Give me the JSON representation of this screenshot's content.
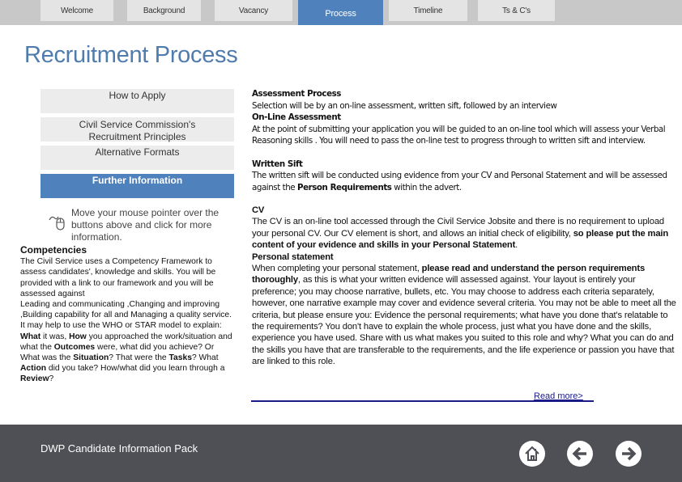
{
  "tabs": [
    {
      "label": "Welcome",
      "active": false
    },
    {
      "label": "Background",
      "active": false
    },
    {
      "label": "Vacancy",
      "active": false
    },
    {
      "label": "Process",
      "active": true
    },
    {
      "label": "Timeline",
      "active": false
    },
    {
      "label": "Ts & C's",
      "active": false
    }
  ],
  "page_title": "Recruitment Process",
  "side_buttons": [
    {
      "label": "How to Apply"
    },
    {
      "label": "Civil Service Commission's Recruitment Principles"
    },
    {
      "label": "Alternative Formats"
    },
    {
      "label": "Further Information",
      "active": true
    }
  ],
  "hint": {
    "icon": "mouse-icon",
    "text": "Move your mouse pointer over the buttons above and click for more information."
  },
  "competencies": [
    [
      {
        "t": "Competencies",
        "h": true
      }
    ],
    [
      {
        "t": "The Civil Service uses a Competency Framework to assess candidates', knowledge and skills. You will be provided with a link to our framework and you will be assessed against"
      }
    ],
    [
      {
        "t": " Leading and communicating ,Changing and improving ,Building capability for all and Managing a quality service."
      }
    ],
    [
      {
        "t": "It may help to use the WHO or STAR model to explain:"
      }
    ],
    [
      {
        "t": "What",
        "b": true
      },
      {
        "t": " it was, "
      },
      {
        "t": "How",
        "b": true
      },
      {
        "t": " you approached the work/situation and what the "
      },
      {
        "t": "Outcomes",
        "b": true
      },
      {
        "t": " were, what did you achieve? Or What was the "
      },
      {
        "t": "Situation",
        "b": true
      },
      {
        "t": "? That were the "
      },
      {
        "t": "Tasks",
        "b": true
      },
      {
        "t": "? What "
      },
      {
        "t": "Action",
        "b": true
      },
      {
        "t": " did you take? How/what did you learn through a "
      },
      {
        "t": "Review",
        "b": true
      },
      {
        "t": "?"
      }
    ]
  ],
  "assessment": [
    [
      {
        "t": "Assessment Process",
        "b": true
      }
    ],
    [
      {
        "t": "Selection will be by an on-line assessment, written sift, followed by an interview"
      }
    ],
    [
      {
        "t": "On-Line Assessment",
        "b": true
      }
    ],
    [
      {
        "t": "At the point of submitting your application you will be guided to an on-line tool which will assess your Verbal Reasoning skills . You will need to pass the on-line test to progress through to written sift and interview."
      }
    ],
    [
      {
        "t": "Written Sift",
        "b": true
      }
    ],
    [
      {
        "t": "The written sift will be conducted using evidence from your CV and Personal Statement and will be assessed against the "
      },
      {
        "t": "Person Requirements",
        "b": true
      },
      {
        "t": " within the advert."
      }
    ]
  ],
  "cv_section": [
    [
      {
        "t": "CV",
        "b": true
      }
    ],
    [
      {
        "t": "The CV is an on-line tool accessed through the Civil Service Jobsite and there is no requirement to upload your personal CV.  Our CV element is short, and allows an initial check of eligibility, "
      },
      {
        "t": "so please put the main content of your evidence and skills in your Personal Statement",
        "b": true
      },
      {
        "t": "."
      }
    ],
    [
      {
        "t": "Personal statement",
        "b": true
      }
    ],
    [
      {
        "t": "When completing your personal statement, "
      },
      {
        "t": "please read and understand the person requirements thoroughly",
        "b": true
      },
      {
        "t": ", as this is what your written evidence will assessed against. Your layout is entirely your preference; you may choose narrative, bullets, etc. You may choose to address each criteria separately, however, one narrative example may cover and evidence several criteria. You may not be able to meet all the criteria, but please ensure you: Evidence the personal requirements; what have you done that's relatable to the requirements? You don't have to explain the whole process, just what you have done and the skills, experience you have used. Share with us what makes you suited to this role and why? What you can do and the skills you have that are transferable to the requirements, and the life experience or passion you have that are linked to this role."
      }
    ]
  ],
  "read_more": "Read more>",
  "footer": {
    "text": "DWP Candidate Information Pack",
    "buttons": [
      {
        "icon": "home-icon"
      },
      {
        "icon": "arrow-left-icon"
      },
      {
        "icon": "arrow-right-icon"
      }
    ]
  },
  "colors": {
    "accent": "#4f81bd",
    "title": "#4f7cad",
    "footer": "#4f5056",
    "topbar": "#c8c8c8"
  }
}
